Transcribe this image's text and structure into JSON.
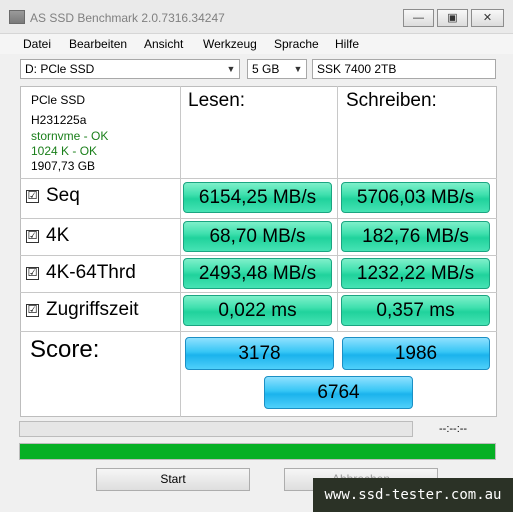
{
  "window": {
    "title": "AS SSD Benchmark 2.0.7316.34247",
    "minimize": "—",
    "maximize": "▣",
    "close": "✕"
  },
  "menu": [
    "Datei",
    "Bearbeiten",
    "Ansicht",
    "Werkzeug",
    "Sprache",
    "Hilfe"
  ],
  "toolbar": {
    "drive": "D: PCle SSD",
    "size": "5 GB",
    "name": "SSK 7400 2TB"
  },
  "info": {
    "model": "PCle SSD",
    "firmware": "H231225a",
    "driver": "stornvme - OK",
    "alignment": "1024 K - OK",
    "capacity": "1907,73 GB"
  },
  "headers": {
    "read": "Lesen:",
    "write": "Schreiben:"
  },
  "rows": [
    {
      "label": "Seq",
      "read": "6154,25 MB/s",
      "write": "5706,03 MB/s",
      "checked": "☑"
    },
    {
      "label": "4K",
      "read": "68,70 MB/s",
      "write": "182,76 MB/s",
      "checked": "☑"
    },
    {
      "label": "4K-64Thrd",
      "read": "2493,48 MB/s",
      "write": "1232,22 MB/s",
      "checked": "☑"
    },
    {
      "label": "Zugriffszeit",
      "read": "0,022 ms",
      "write": "0,357 ms",
      "checked": "☑"
    }
  ],
  "score": {
    "label": "Score:",
    "read": "3178",
    "write": "1986",
    "total": "6764"
  },
  "progress": {
    "elapsed": "--:--:--",
    "overall_fraction": 1.0,
    "colors": {
      "fill": "#06b025"
    }
  },
  "buttons": {
    "start": "Start",
    "abort": "Abbrechen"
  },
  "watermark": "www.ssd-tester.com.au"
}
